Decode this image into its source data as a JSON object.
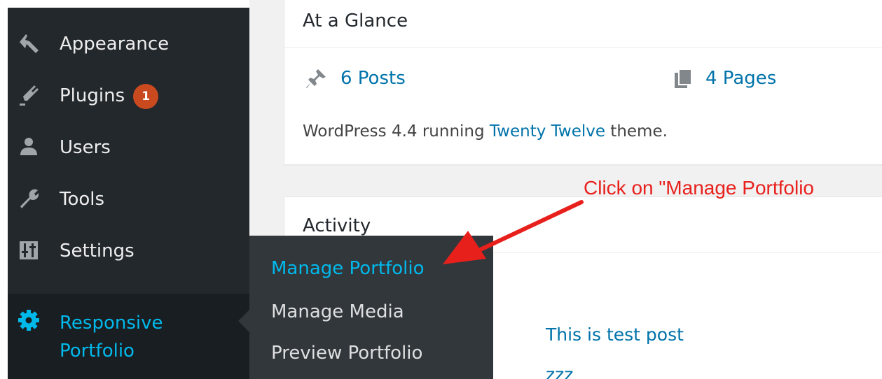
{
  "sidebar": {
    "items": [
      {
        "label": "Appearance",
        "icon": "paintbrush-icon"
      },
      {
        "label": "Plugins",
        "icon": "plugin-icon",
        "badge": "1"
      },
      {
        "label": "Users",
        "icon": "users-icon"
      },
      {
        "label": "Tools",
        "icon": "wrench-icon"
      },
      {
        "label": "Settings",
        "icon": "settings-icon"
      },
      {
        "label": "Responsive Portfolio",
        "icon": "gear-icon",
        "active": true
      }
    ],
    "submenu": [
      "Manage Portfolio",
      "Manage Media",
      "Preview Portfolio"
    ]
  },
  "glance": {
    "title": "At a Glance",
    "posts": "6 Posts",
    "pages": "4 Pages",
    "version_prefix": "WordPress 4.4 running ",
    "theme": "Twenty Twelve",
    "version_suffix": " theme."
  },
  "activity": {
    "title": "Activity",
    "post": "This is test post zzz"
  },
  "annotation": {
    "text": "Click on \"Manage Portfolio"
  },
  "colors": {
    "sidebar_bg": "#23282d",
    "flyout_bg": "#32373c",
    "accent": "#00b9eb",
    "link": "#0073aa",
    "badge": "#ca4a1f",
    "annotation": "#e8201c"
  }
}
